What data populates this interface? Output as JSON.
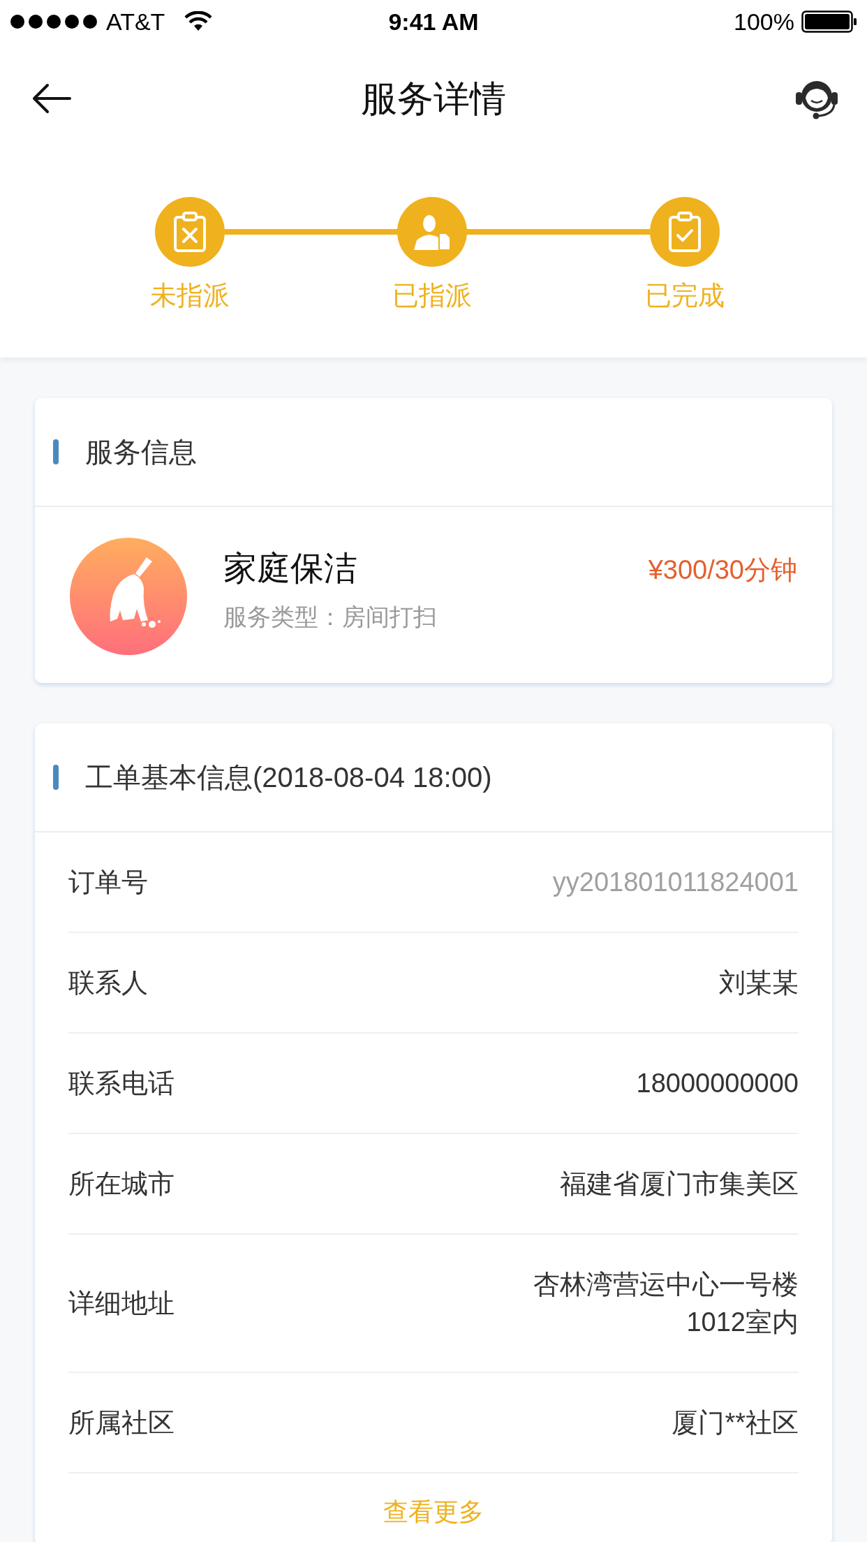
{
  "status_bar": {
    "carrier": "AT&T",
    "time": "9:41 AM",
    "battery": "100%"
  },
  "nav": {
    "title": "服务详情"
  },
  "steps": [
    {
      "label": "未指派",
      "kind": "cancel",
      "done": true
    },
    {
      "label": "已指派",
      "kind": "assign",
      "done": true
    },
    {
      "label": "已完成",
      "kind": "complete",
      "done": true
    }
  ],
  "service_card": {
    "title": "服务信息",
    "name": "家庭保洁",
    "type": "服务类型：房间打扫",
    "price": "¥300/30分钟"
  },
  "order_card": {
    "title": "工单基本信息(2018-08-04 18:00)",
    "rows": [
      {
        "label": "订单号",
        "value": "yy201801011824001",
        "muted": true
      },
      {
        "label": "联系人",
        "value": "刘某某",
        "muted": false
      },
      {
        "label": "联系电话",
        "value": "18000000000",
        "muted": false
      },
      {
        "label": "所在城市",
        "value": "福建省厦门市集美区",
        "muted": false
      },
      {
        "label": "详细地址",
        "value": "杏林湾营运中心一号楼\n1012室内",
        "muted": false
      },
      {
        "label": "所属社区",
        "value": "厦门**社区",
        "muted": false
      }
    ],
    "more": "查看更多"
  }
}
